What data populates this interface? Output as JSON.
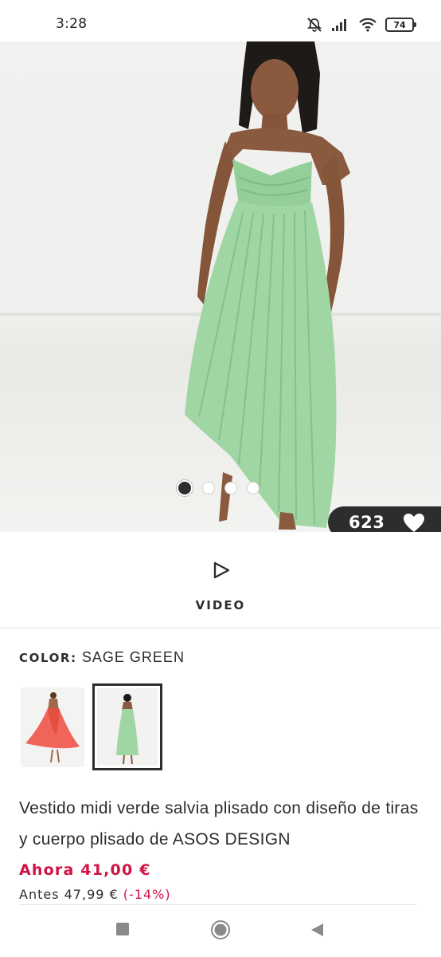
{
  "status_bar": {
    "time": "3:28",
    "battery": "74"
  },
  "gallery": {
    "saves_count": "623",
    "dots": [
      true,
      false,
      false,
      false
    ]
  },
  "video": {
    "label": "VIDEO"
  },
  "color": {
    "label": "COLOR:",
    "value": "SAGE GREEN"
  },
  "product": {
    "title": "Vestido midi verde salvia plisado con diseño de tiras y cuerpo plisado de ASOS DESIGN",
    "price_now": "Ahora 41,00 €",
    "price_was": "Antes 47,99 €",
    "discount": "(-14%)"
  },
  "colors": {
    "accent": "#d01345",
    "dark": "#2d2d2d",
    "dress": "#9fd6a4"
  }
}
